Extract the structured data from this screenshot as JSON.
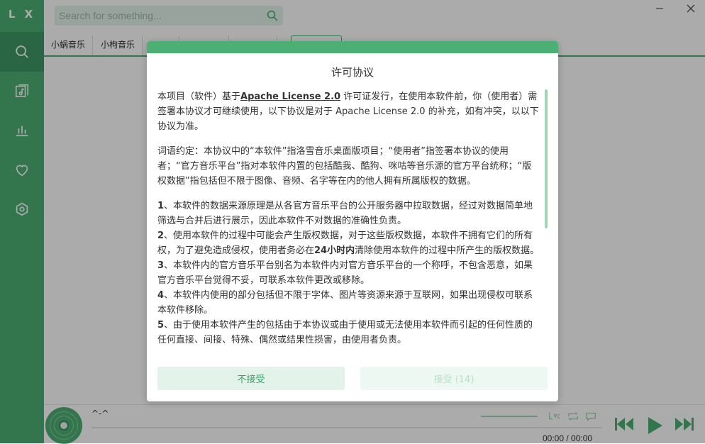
{
  "app": {
    "logo": "L X"
  },
  "colors": {
    "accent": "#4caf74",
    "accent_dark": "#3f9865",
    "accent_light": "#e3f3ea"
  },
  "sidebar": {
    "items": [
      {
        "icon": "search-icon",
        "active": true
      },
      {
        "icon": "song-list-icon",
        "active": false
      },
      {
        "icon": "leaderboard-icon",
        "active": false
      },
      {
        "icon": "heart-icon",
        "active": false
      },
      {
        "icon": "settings-icon",
        "active": false
      }
    ]
  },
  "search": {
    "placeholder": "Search for something..."
  },
  "window": {
    "minimize_icon": "minimize-icon",
    "close_icon": "close-icon"
  },
  "tabs": [
    "小蜗音乐",
    "小枸音乐"
  ],
  "player": {
    "title": "^-^",
    "time": "00:00 / 00:00"
  },
  "modal": {
    "title": "许可协议",
    "p1_pre": "本项目（软件）基于",
    "p1_link": "Apache License 2.0",
    "p1_post": " 许可证发行，在使用本软件前，你（使用者）需签署本协议才可继续使用，以下协议是对于 Apache License 2.0 的补充，如有冲突，以以下协议为准。",
    "p2": "词语约定：本协议中的“本软件”指洛雪音乐桌面版项目；“使用者”指签署本协议的使用者；“官方音乐平台”指对本软件内置的包括酷我、酷狗、咪咕等音乐源的官方平台统称；“版权数据”指包括但不限于图像、音频、名字等在内的他人拥有所属版权的数据。",
    "i1_num": "1",
    "i1_text": "、本软件的数据来源原理是从各官方音乐平台的公开服务器中拉取数据，经过对数据简单地筛选与合并后进行展示，因此本软件不对数据的准确性负责。",
    "i2_num": "2",
    "i2_pre": "、使用本软件的过程中可能会产生版权数据，对于这些版权数据，本软件不拥有它们的所有权，为了避免造成侵权，使用者务必在",
    "i2_bold": "24小时内",
    "i2_post": "清除使用本软件的过程中所产生的版权数据。",
    "i3_num": "3",
    "i3_text": "、本软件内的官方音乐平台别名为本软件内对官方音乐平台的一个称呼，不包含恶意，如果官方音乐平台觉得不妥，可联系本软件更改或移除。",
    "i4_num": "4",
    "i4_text": "、本软件内使用的部分包括但不限于字体、图片等资源来源于互联网，如果出现侵权可联系本软件移除。",
    "i5_num": "5",
    "i5_text": "、由于使用本软件产生的包括由于本协议或由于使用或无法使用本软件而引起的任何性质的任何直接、间接、特殊、偶然或结果性损害，由使用者负责。",
    "reject_label": "不接受",
    "accept_label": "接受 (14)"
  }
}
